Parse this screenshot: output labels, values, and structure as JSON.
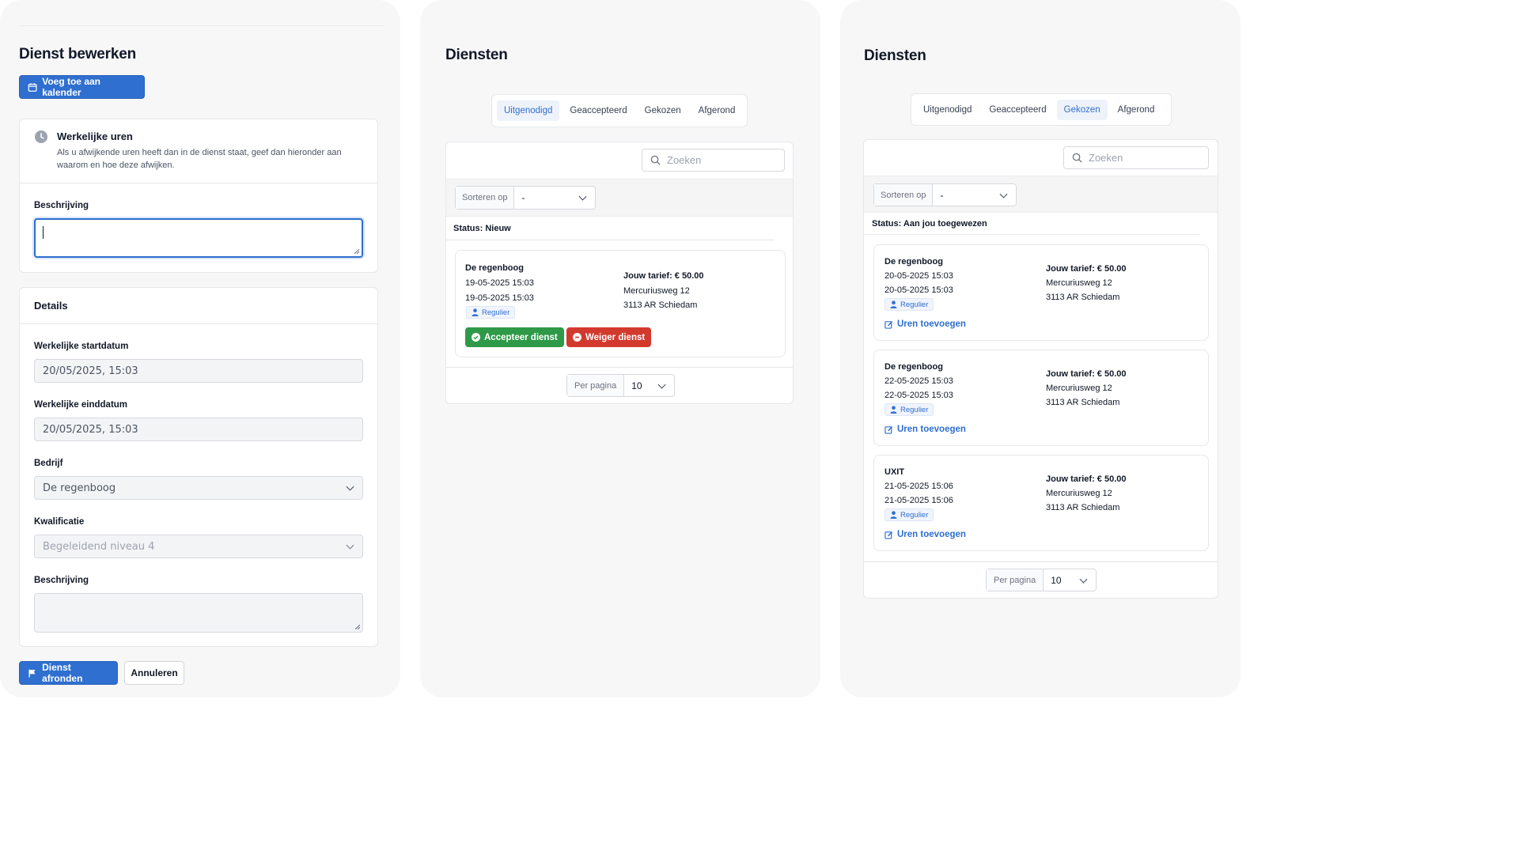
{
  "edit": {
    "title": "Dienst bewerken",
    "calendar_button": "Voeg toe aan kalender",
    "hours": {
      "title": "Werkelijke uren",
      "text_line1": "Als u afwijkende uren heeft dan in de dienst staat, geef dan hieronder aan",
      "text_line2": "waarom en hoe deze afwijken.",
      "desc_label": "Beschrijving",
      "desc_value": ""
    },
    "details": {
      "title": "Details",
      "start_label": "Werkelijke startdatum",
      "start_value": "20/05/2025, 15:03",
      "end_label": "Werkelijke einddatum",
      "end_value": "20/05/2025, 15:03",
      "company_label": "Bedrijf",
      "company_value": "De regenboog",
      "qual_label": "Kwalificatie",
      "qual_value": "Begeleidend niveau 4",
      "desc_label": "Beschrijving",
      "desc_value": ""
    },
    "finish_button": "Dienst afronden",
    "cancel_button": "Annuleren"
  },
  "list_invited": {
    "title": "Diensten",
    "tabs": [
      "Uitgenodigd",
      "Geaccepteerd",
      "Gekozen",
      "Afgerond"
    ],
    "active_tab": "Uitgenodigd",
    "search_placeholder": "Zoeken",
    "sort_label": "Sorteren op",
    "sort_value": "-",
    "status": "Status: Nieuw",
    "shift": {
      "name": "De regenboog",
      "start": "19-05-2025 15:03",
      "end": "19-05-2025 15:03",
      "badge": "Regulier",
      "rate": "Jouw tarief: € 50.00",
      "street": "Mercuriusweg 12",
      "city": "3113 AR Schiedam",
      "accept": "Accepteer dienst",
      "reject": "Weiger dienst"
    },
    "per_page_label": "Per pagina",
    "per_page_value": "10"
  },
  "list_chosen": {
    "title": "Diensten",
    "tabs": [
      "Uitgenodigd",
      "Geaccepteerd",
      "Gekozen",
      "Afgerond"
    ],
    "active_tab": "Gekozen",
    "search_placeholder": "Zoeken",
    "sort_label": "Sorteren op",
    "sort_value": "-",
    "status": "Status: Aan jou toegewezen",
    "shifts": [
      {
        "name": "De regenboog",
        "start": "20-05-2025 15:03",
        "end": "20-05-2025 15:03",
        "badge": "Regulier",
        "rate": "Jouw tarief: € 50.00",
        "street": "Mercuriusweg 12",
        "city": "3113 AR Schiedam",
        "link": "Uren toevoegen"
      },
      {
        "name": "De regenboog",
        "start": "22-05-2025 15:03",
        "end": "22-05-2025 15:03",
        "badge": "Regulier",
        "rate": "Jouw tarief: € 50.00",
        "street": "Mercuriusweg 12",
        "city": "3113 AR Schiedam",
        "link": "Uren toevoegen"
      },
      {
        "name": "UXIT",
        "start": "21-05-2025 15:06",
        "end": "21-05-2025 15:06",
        "badge": "Regulier",
        "rate": "Jouw tarief: € 50.00",
        "street": "Mercuriusweg 12",
        "city": "3113 AR Schiedam",
        "link": "Uren toevoegen"
      }
    ],
    "per_page_label": "Per pagina",
    "per_page_value": "10"
  },
  "colors": {
    "primary": "#2f6fd0",
    "accept": "#2e9a48",
    "reject": "#d23a2e",
    "panel_bg": "#f7f7f8"
  },
  "icons": {
    "calendar": "calendar-icon",
    "clock": "clock-icon",
    "chevron": "chevron-down-icon",
    "search": "search-icon",
    "user": "user-icon",
    "check": "check-circle-icon",
    "minus": "minus-circle-icon",
    "edit": "edit-icon",
    "flag": "flag-icon"
  }
}
